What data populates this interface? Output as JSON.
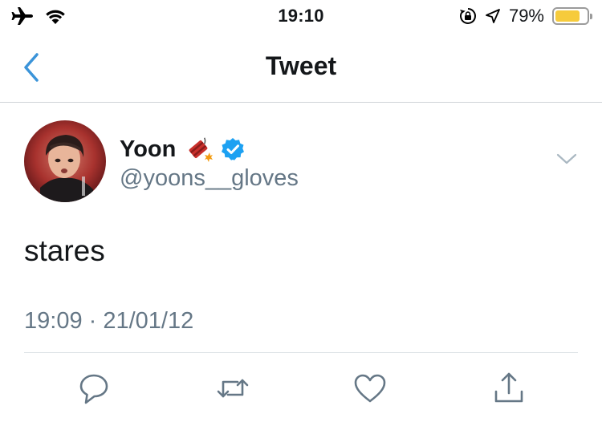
{
  "status_bar": {
    "time": "19:10",
    "battery_percent": "79%",
    "battery_level": 0.79,
    "battery_color": "#f6cb3c",
    "icons": [
      "airplane-icon",
      "wifi-icon",
      "orientation-lock-icon",
      "location-arrow-icon",
      "battery-icon"
    ]
  },
  "nav": {
    "title": "Tweet",
    "back_icon": "chevron-left-icon",
    "accent_color": "#3b94d9"
  },
  "tweet": {
    "author_name": "Yoon",
    "name_emoji": "firecracker-icon",
    "verified_icon": "verified-badge-icon",
    "handle": "@yoons__gloves",
    "text": "stares",
    "timestamp": "19:09 · 21/01/12",
    "menu_icon": "chevron-down-icon"
  },
  "actions": [
    {
      "name": "reply-button",
      "icon": "speech-bubble-icon"
    },
    {
      "name": "retweet-button",
      "icon": "retweet-icon"
    },
    {
      "name": "like-button",
      "icon": "heart-icon"
    },
    {
      "name": "share-button",
      "icon": "share-icon"
    }
  ]
}
